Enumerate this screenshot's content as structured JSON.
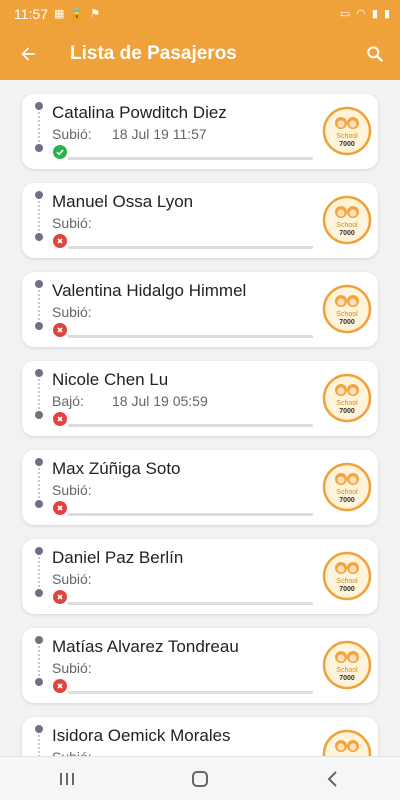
{
  "status_bar": {
    "time": "11:57"
  },
  "app_bar": {
    "title": "Lista de Pasajeros"
  },
  "passengers": [
    {
      "name": "Catalina Powditch Diez",
      "status": "Subió:",
      "time": "18 Jul 19 11:57",
      "state": "ok"
    },
    {
      "name": "Manuel Ossa Lyon",
      "status": "Subió:",
      "time": "",
      "state": "fail"
    },
    {
      "name": "Valentina Hidalgo Himmel",
      "status": "Subió:",
      "time": "",
      "state": "fail"
    },
    {
      "name": "Nicole Chen Lu",
      "status": "Bajó:",
      "time": "18 Jul 19 05:59",
      "state": "fail"
    },
    {
      "name": "Max Zúñiga Soto",
      "status": "Subió:",
      "time": "",
      "state": "fail"
    },
    {
      "name": "Daniel Paz Berlín",
      "status": "Subió:",
      "time": "",
      "state": "fail"
    },
    {
      "name": "Matías Alvarez Tondreau",
      "status": "Subió:",
      "time": "",
      "state": "fail"
    },
    {
      "name": "Isidora Oemick Morales",
      "status": "Subió:",
      "time": "",
      "state": "fail"
    }
  ],
  "logo_text": {
    "line1": "School",
    "line2": "7000"
  },
  "colors": {
    "accent": "#f0a23a",
    "ok": "#2bb24c",
    "fail": "#e0443e"
  },
  "icons": {
    "back": "arrow-back-icon",
    "search": "search-icon",
    "ok": "check-circle-icon",
    "fail": "x-circle-icon",
    "nav_recents": "recents-icon",
    "nav_home": "home-icon",
    "nav_back": "back-icon"
  }
}
